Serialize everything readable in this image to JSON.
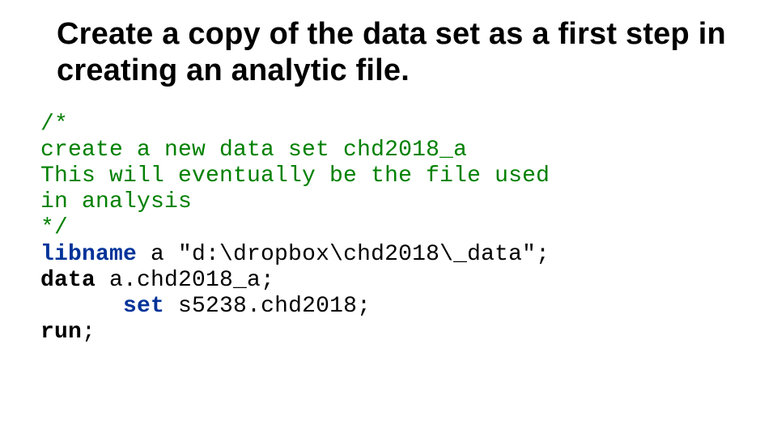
{
  "title": "Create a copy of the data set as a first step in creating an analytic file.",
  "code": {
    "c1": "/*",
    "c2": "create a new data set chd2018_a",
    "c3": "This will eventually be the file used",
    "c4": "in analysis",
    "c5": "*/",
    "kw_libname": "libname",
    "lib_rest": " a \"d:\\dropbox\\chd2018\\_data\";",
    "kw_data": "data",
    "data_rest": " a.chd2018_a;",
    "indent": "      ",
    "kw_set": "set",
    "set_rest": " s5238.chd2018;",
    "kw_run": "run",
    "run_rest": ";"
  }
}
